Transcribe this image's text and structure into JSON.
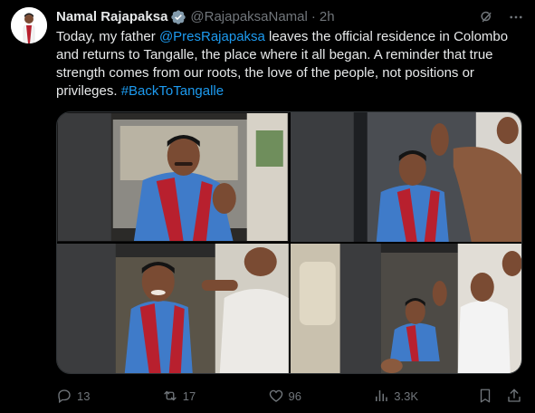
{
  "author": {
    "name": "Namal Rajapaksa",
    "handle": "@RajapaksaNamal",
    "time": "2h"
  },
  "tweet": {
    "pre": "Today, my father ",
    "mention": "@PresRajapaksa",
    "mid": " leaves the official residence in Colombo and returns to Tangalle, the place where it all began. A reminder that true strength comes from our roots, the love of the people, not positions or privileges. ",
    "hashtag": "#BackToTangalle"
  },
  "actions": {
    "replies": "13",
    "reposts": "17",
    "likes": "96",
    "views": "3.3K"
  },
  "colors": {
    "background": "#000000",
    "text": "#e7e9ea",
    "muted": "#71767b",
    "link": "#1d9bf0",
    "verified": "#829aab",
    "shirt": "#3f7bc9",
    "shawl": "#b8202e"
  },
  "icons": [
    "verified-badge-icon",
    "grok-icon",
    "more-icon",
    "reply-icon",
    "repost-icon",
    "like-icon",
    "views-icon",
    "bookmark-icon",
    "share-icon"
  ]
}
